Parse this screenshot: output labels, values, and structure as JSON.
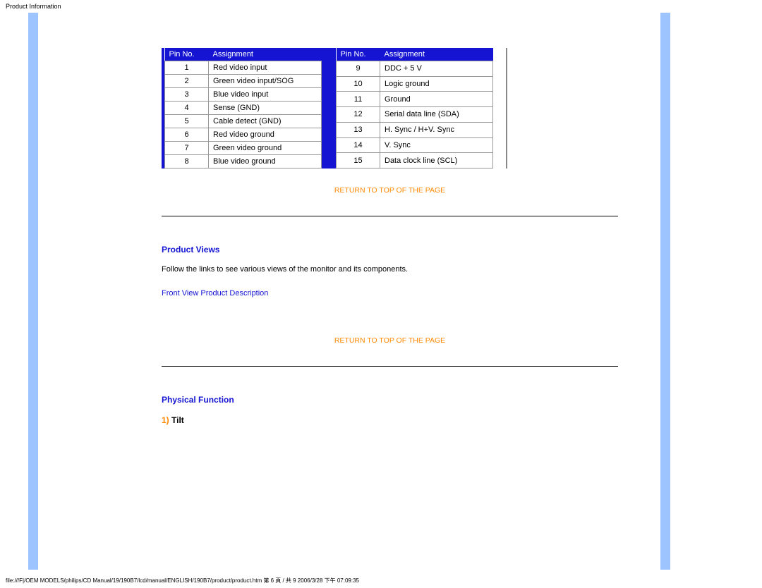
{
  "header": {
    "title": "Product Information"
  },
  "table": {
    "header_pin": "Pin No.",
    "header_assign": "Assignment",
    "left": [
      {
        "pin": "1",
        "assign": "Red video input"
      },
      {
        "pin": "2",
        "assign": "Green video input/SOG"
      },
      {
        "pin": "3",
        "assign": "Blue video input"
      },
      {
        "pin": "4",
        "assign": "Sense (GND)"
      },
      {
        "pin": "5",
        "assign": "Cable detect (GND)"
      },
      {
        "pin": "6",
        "assign": "Red video ground"
      },
      {
        "pin": "7",
        "assign": "Green video ground"
      },
      {
        "pin": "8",
        "assign": "Blue video ground"
      }
    ],
    "right": [
      {
        "pin": "9",
        "assign": "DDC + 5 V"
      },
      {
        "pin": "10",
        "assign": "Logic ground"
      },
      {
        "pin": "11",
        "assign": "Ground"
      },
      {
        "pin": "12",
        "assign": "Serial data line (SDA)"
      },
      {
        "pin": "13",
        "assign": "H. Sync / H+V. Sync"
      },
      {
        "pin": "14",
        "assign": "V. Sync"
      },
      {
        "pin": "15",
        "assign": "Data clock line (SCL)"
      }
    ]
  },
  "links": {
    "return_top": "RETURN TO TOP OF THE PAGE",
    "front_view": "Front View Product Description"
  },
  "sections": {
    "product_views": "Product Views",
    "product_views_body": "Follow the links to see various views of the monitor and its components.",
    "physical_function": "Physical Function",
    "tilt_num": "1)",
    "tilt_label": "Tilt"
  },
  "footer": {
    "path": "file:///F|/OEM MODELS/philips/CD Manual/19/190B7/lcd/manual/ENGLISH/190B7/product/product.htm 第 6 頁 / 共 9 2006/3/28 下午 07:09:35"
  }
}
